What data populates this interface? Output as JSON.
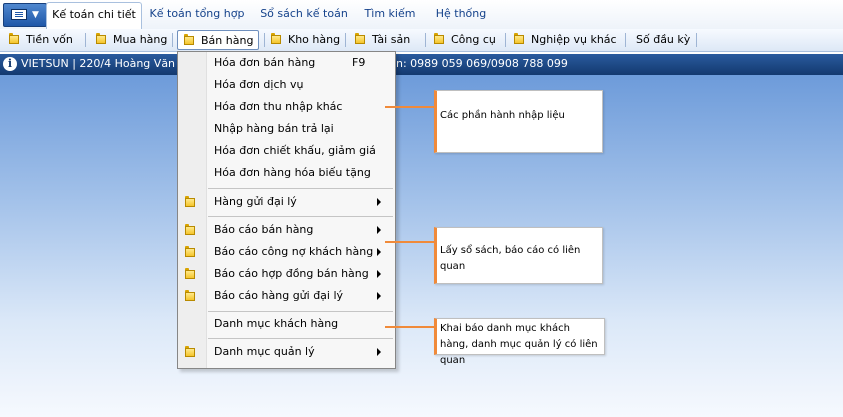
{
  "colors": {
    "accent": "#f08a3a",
    "info_bar": "#1f4b87",
    "main_bg": "#6d9bda"
  },
  "top_tabs": [
    "Kế toán chi tiết",
    "Kế toán tổng hợp",
    "Sổ sách kế toán",
    "Tìm kiếm",
    "Hệ thống"
  ],
  "ribbon": [
    "Tiền vốn",
    "Mua hàng",
    "Bán hàng",
    "Kho hàng",
    "Tài sản",
    "Công cụ",
    "Nghiệp vụ khác",
    "Số đầu kỳ"
  ],
  "info_bar": {
    "left": "VIETSUN | 220/4 Hoàng Văn Th",
    "right": "n: 0989 059 069/0908 788 099"
  },
  "menu": {
    "items": [
      {
        "label": "Hóa đơn bán hàng",
        "shortcut": "F9"
      },
      {
        "label": "Hóa đơn dịch vụ"
      },
      {
        "label": "Hóa đơn thu nhập khác"
      },
      {
        "label": "Nhập hàng bán trả lại"
      },
      {
        "label": "Hóa đơn chiết khấu, giảm giá"
      },
      {
        "label": "Hóa đơn hàng hóa biếu tặng"
      },
      {
        "label": "Hàng gửi đại lý"
      },
      {
        "label": "Báo cáo bán hàng"
      },
      {
        "label": "Báo cáo công nợ khách hàng"
      },
      {
        "label": "Báo cáo hợp đồng bán hàng"
      },
      {
        "label": "Báo cáo hàng gửi đại lý"
      },
      {
        "label": "Danh mục khách hàng"
      },
      {
        "label": "Danh mục quản lý"
      }
    ]
  },
  "callouts": [
    "Các phần hành nhập liệu",
    "Lấy sổ sách, báo cáo có liên quan",
    "Khai báo danh mục khách hàng, danh mục quản lý có liên quan"
  ]
}
